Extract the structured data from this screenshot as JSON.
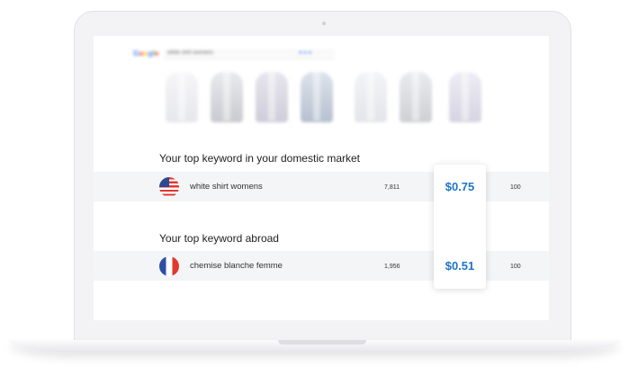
{
  "search": {
    "logo_letters": [
      "G",
      "o",
      "o",
      "g",
      "l",
      "e"
    ],
    "query": "white shirt womens",
    "icons": "● ● ●"
  },
  "domestic": {
    "title": "Your top keyword in your domestic market",
    "flag_icon": "us-flag-icon",
    "keyword": "white shirt womens",
    "volume": "7,811",
    "cpc": "$0.75",
    "score": "100"
  },
  "abroad": {
    "title": "Your top keyword abroad",
    "flag_icon": "france-flag-icon",
    "keyword": "chemise blanche femme",
    "volume": "1,956",
    "cpc": "$0.51",
    "score": "100"
  },
  "colors": {
    "accent": "#1f74c9",
    "row_background": "#f3f5f6"
  }
}
